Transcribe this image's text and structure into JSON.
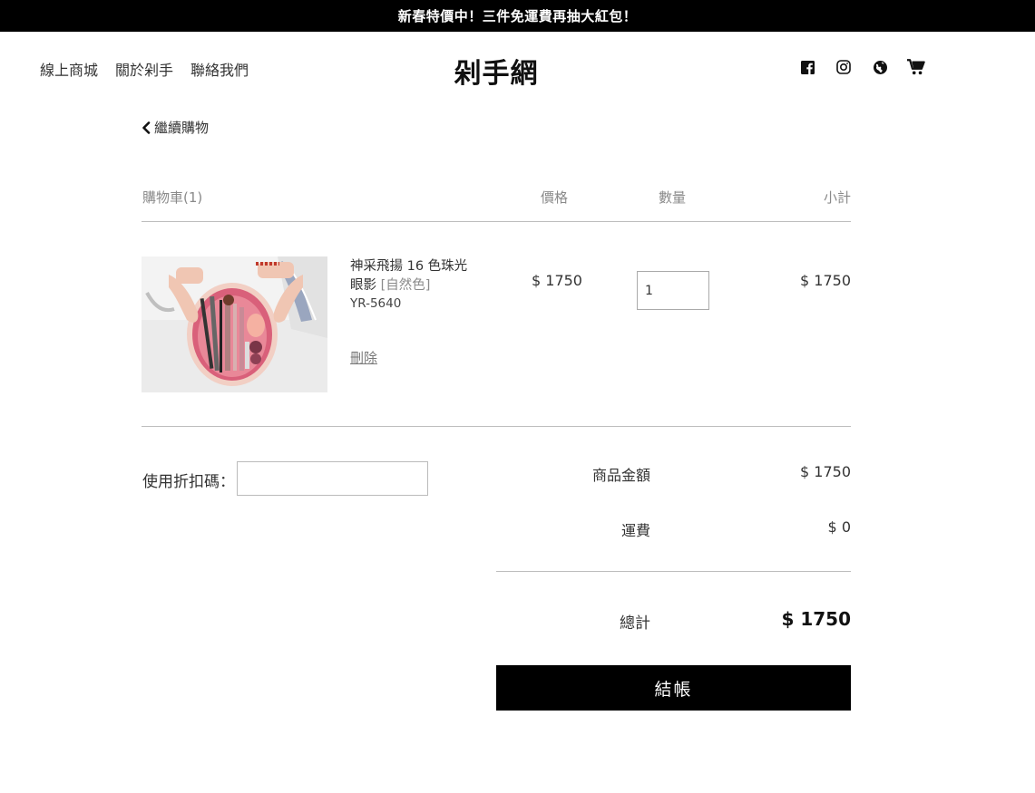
{
  "announcement": "新春特價中！三件免運費再抽大紅包！",
  "nav": {
    "links": [
      "線上商城",
      "關於剁手",
      "聯絡我們"
    ],
    "logo": "剁手網",
    "icons": [
      "facebook-icon",
      "instagram-icon",
      "globe-icon",
      "cart-icon"
    ]
  },
  "back_link": "繼續購物",
  "cart_header": {
    "title": "購物車(1)",
    "price": "價格",
    "quantity": "數量",
    "subtotal": "小計"
  },
  "item": {
    "name": "神采飛揚 16 色珠光眼影",
    "variant": "[自然色]",
    "sku": "YR-5640",
    "price": "$ 1750",
    "quantity": "1",
    "subtotal": "$ 1750",
    "delete_label": "刪除"
  },
  "coupon": {
    "label": "使用折扣碼：",
    "value": ""
  },
  "summary": {
    "items_label": "商品金額",
    "items_value": "$ 1750",
    "shipping_label": "運費",
    "shipping_value": "$ 0",
    "total_label": "總計",
    "total_value": "$ 1750"
  },
  "checkout_label": "結帳",
  "colors": {
    "accent": "#000000",
    "muted": "#8a8a8a",
    "divider": "#bdbdbd"
  }
}
